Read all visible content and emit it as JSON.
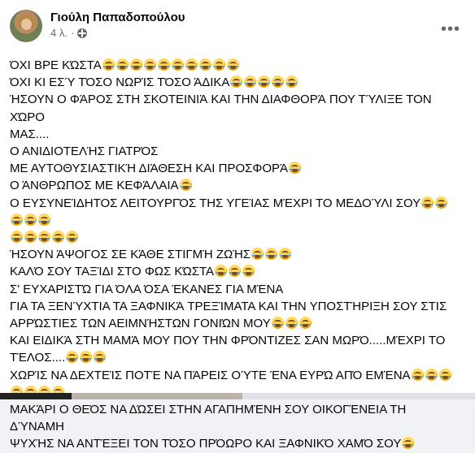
{
  "post": {
    "author": "Γιούλη Παπαδοπούλου",
    "time": "4 λ.",
    "more": "•••",
    "lines": [
      {
        "text": "ΌΧΙ ΒΡΕ ΚΏΣΤΑ",
        "emoji": 10
      },
      {
        "text": "ΌΧΙ ΚΙ ΕΣΎ ΤΌΣΟ ΝΩΡΊΣ ΤΌΣΟ ΆΔΙΚΑ",
        "emoji": 5
      },
      {
        "text": "ΉΣΟΥΝ Ο ΦΆΡΟΣ ΣΤΗ ΣΚΟΤΕΙΝΙΆ ΚΑΙ ΤΗΝ ΔΙΑΦΘΟΡΆ ΠΟΥ ΤΎΛΙΞΕ ΤΟΝ ΧΏΡΟ",
        "emoji": 0
      },
      {
        "text": "ΜΑΣ....",
        "emoji": 0
      },
      {
        "text": "Ο ΑΝΙΔΙΟΤΕΛΉΣ ΓΙΑΤΡΌΣ",
        "emoji": 0
      },
      {
        "text": "ΜΕ ΑΥΤΟΘΥΣΙΑΣΤΙΚΉ ΔΙΆΘΕΣΗ ΚΑΙ ΠΡΟΣΦΟΡΆ",
        "emoji": 1
      },
      {
        "text": "Ο ΆΝΘΡΩΠΟΣ ΜΕ ΚΕΦΆΛΑΙΑ",
        "emoji": 1
      },
      {
        "text": "Ο ΕΥΣΥΝΕΊΔΗΤΟΣ ΛΕΙΤΟΥΡΓΌΣ ΤΗΣ ΥΓΕΊΑΣ ΜΈΧΡΙ ΤΟ ΜΕΔΟΎΛΙ ΣΟΥ",
        "emoji": 5
      },
      {
        "text": "",
        "emoji": 5
      },
      {
        "text": "ΉΣΟΥΝ ΆΨΟΓΟΣ ΣΕ ΚΆΘΕ ΣΤΙΓΜΉ ΖΩΉΣ",
        "emoji": 3
      },
      {
        "text": "ΚΑΛΌ ΣΟΥ ΤΑΞΊΔΙ ΣΤΟ ΦΩΣ ΚΏΣΤΑ",
        "emoji": 3
      },
      {
        "text": "Σ' ΕΥΧΑΡΙΣΤΏ ΓΙΑ ΌΛΑ ΌΣΑ ΈΚΑΝΕΣ ΓΙΑ ΜΈΝΑ",
        "emoji": 0
      },
      {
        "text": "ΓΙΑ ΤΑ ΞΕΝΎΧΤΙΑ ΤΑ ΞΑΦΝΙΚΆ ΤΡΕΞΊΜΑΤΑ ΚΑΙ ΤΗΝ ΥΠΟΣΤΉΡΙΞΗ ΣΟΥ ΣΤΙΣ",
        "emoji": 0
      },
      {
        "text": "ΑΡΡΏΣΤΙΕΣ ΤΩΝ ΑΕΙΜΝΉΣΤΩΝ ΓΟΝΙΏΝ ΜΟΥ",
        "emoji": 3
      },
      {
        "text": "ΚΑΙ ΕΙΔΙΚΆ ΣΤΗ ΜΑΜΆ ΜΟΥ ΠΟΥ ΤΗΝ ΦΡΌΝΤΙΖΕΣ ΣΑΝ ΜΩΡΌ.....ΜΈΧΡΙ ΤΟ",
        "emoji": 0
      },
      {
        "text": "ΤΈΛΟΣ....",
        "emoji": 3
      },
      {
        "text": "ΧΩΡΊΣ ΝΑ ΔΕΧΤΕΊΣ ΠΟΤΈ ΝΑ ΠΆΡΕΙΣ ΟΎΤΕ ΈΝΑ ΕΥΡΏ ΑΠΌ ΕΜΈΝΑ",
        "emoji": 7
      },
      {
        "text": "ΜΑΚΆΡΙ Ο ΘΕΌΣ ΝΑ ΔΏΣΕΙ ΣΤΗΝ ΑΓΑΠΗΜΈΝΗ ΣΟΥ ΟΙΚΟΓΈΝΕΙΑ ΤΗ ΔΎΝΑΜΗ",
        "emoji": 0
      },
      {
        "text": "ΨΥΧΉΣ ΝΑ ΑΝΤΈΞΕΙ ΤΟΝ ΤΌΣΟ ΠΡΌΩΡΟ ΚΑΙ ΞΑΦΝΙΚΌ ΧΑΜΌ ΣΟΥ",
        "emoji": 1
      }
    ]
  }
}
